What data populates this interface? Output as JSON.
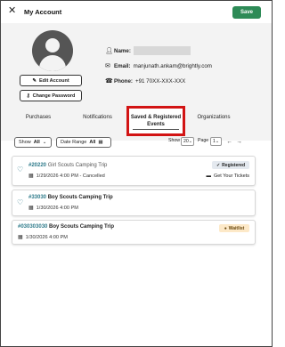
{
  "header": {
    "title": "My Account",
    "close_icon": "close-icon",
    "save_label": "Save",
    "save_color": "#2e8b57"
  },
  "profile": {
    "edit_label": "Edit Account",
    "password_label": "Change Password",
    "name_label": "Name:",
    "email_label": "Email:",
    "email_value": "manjunath.ankam@brightly.com",
    "phone_label": "Phone:",
    "phone_value": "+91 70XX-XXX-XXX"
  },
  "tabs": [
    {
      "label": "Purchases"
    },
    {
      "label": "Notifications"
    },
    {
      "label": "Saved & Registered Events",
      "active": true,
      "highlight_color": "#d21414"
    },
    {
      "label": "Organizations"
    }
  ],
  "filters": {
    "show_label": "Show",
    "show_value": "All",
    "date_label": "Date Range",
    "date_value": "All"
  },
  "pagination": {
    "show_label": "Show",
    "per_page": "20",
    "page_label": "Page",
    "page": "1"
  },
  "events": [
    {
      "id": "#20220",
      "name": "Girl Scouts Camping Trip",
      "datetime": "1/29/2026 4:00 PM - Cancelled",
      "badge": "Registered",
      "action": "Get Your Tickets"
    },
    {
      "id": "#33030",
      "name": "Boy Scouts Camping Trip",
      "datetime": "1/30/2026 4:00 PM"
    },
    {
      "id": "#030303030",
      "name": "Boy Scouts Camping Trip",
      "datetime": "1/30/2026 4:00 PM",
      "badge": "Waitlist"
    }
  ]
}
